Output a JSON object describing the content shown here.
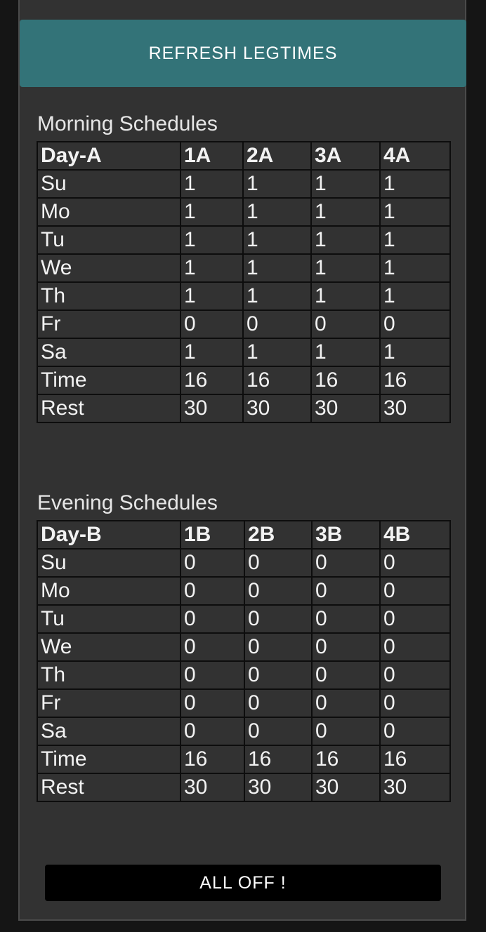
{
  "buttons": {
    "refresh_label": "REFRESH LEGTIMES",
    "alloff_label": "ALL OFF !"
  },
  "morning": {
    "title": "Morning Schedules",
    "headers": [
      "Day-A",
      "1A",
      "2A",
      "3A",
      "4A"
    ],
    "rows": [
      [
        "Su",
        "1",
        "1",
        "1",
        "1"
      ],
      [
        "Mo",
        "1",
        "1",
        "1",
        "1"
      ],
      [
        "Tu",
        "1",
        "1",
        "1",
        "1"
      ],
      [
        "We",
        "1",
        "1",
        "1",
        "1"
      ],
      [
        "Th",
        "1",
        "1",
        "1",
        "1"
      ],
      [
        "Fr",
        "0",
        "0",
        "0",
        "0"
      ],
      [
        "Sa",
        "1",
        "1",
        "1",
        "1"
      ],
      [
        "Time",
        "16",
        "16",
        "16",
        "16"
      ],
      [
        "Rest",
        "30",
        "30",
        "30",
        "30"
      ]
    ]
  },
  "evening": {
    "title": "Evening Schedules",
    "headers": [
      "Day-B",
      "1B",
      "2B",
      "3B",
      "4B"
    ],
    "rows": [
      [
        "Su",
        "0",
        "0",
        "0",
        "0"
      ],
      [
        "Mo",
        "0",
        "0",
        "0",
        "0"
      ],
      [
        "Tu",
        "0",
        "0",
        "0",
        "0"
      ],
      [
        "We",
        "0",
        "0",
        "0",
        "0"
      ],
      [
        "Th",
        "0",
        "0",
        "0",
        "0"
      ],
      [
        "Fr",
        "0",
        "0",
        "0",
        "0"
      ],
      [
        "Sa",
        "0",
        "0",
        "0",
        "0"
      ],
      [
        "Time",
        "16",
        "16",
        "16",
        "16"
      ],
      [
        "Rest",
        "30",
        "30",
        "30",
        "30"
      ]
    ]
  }
}
